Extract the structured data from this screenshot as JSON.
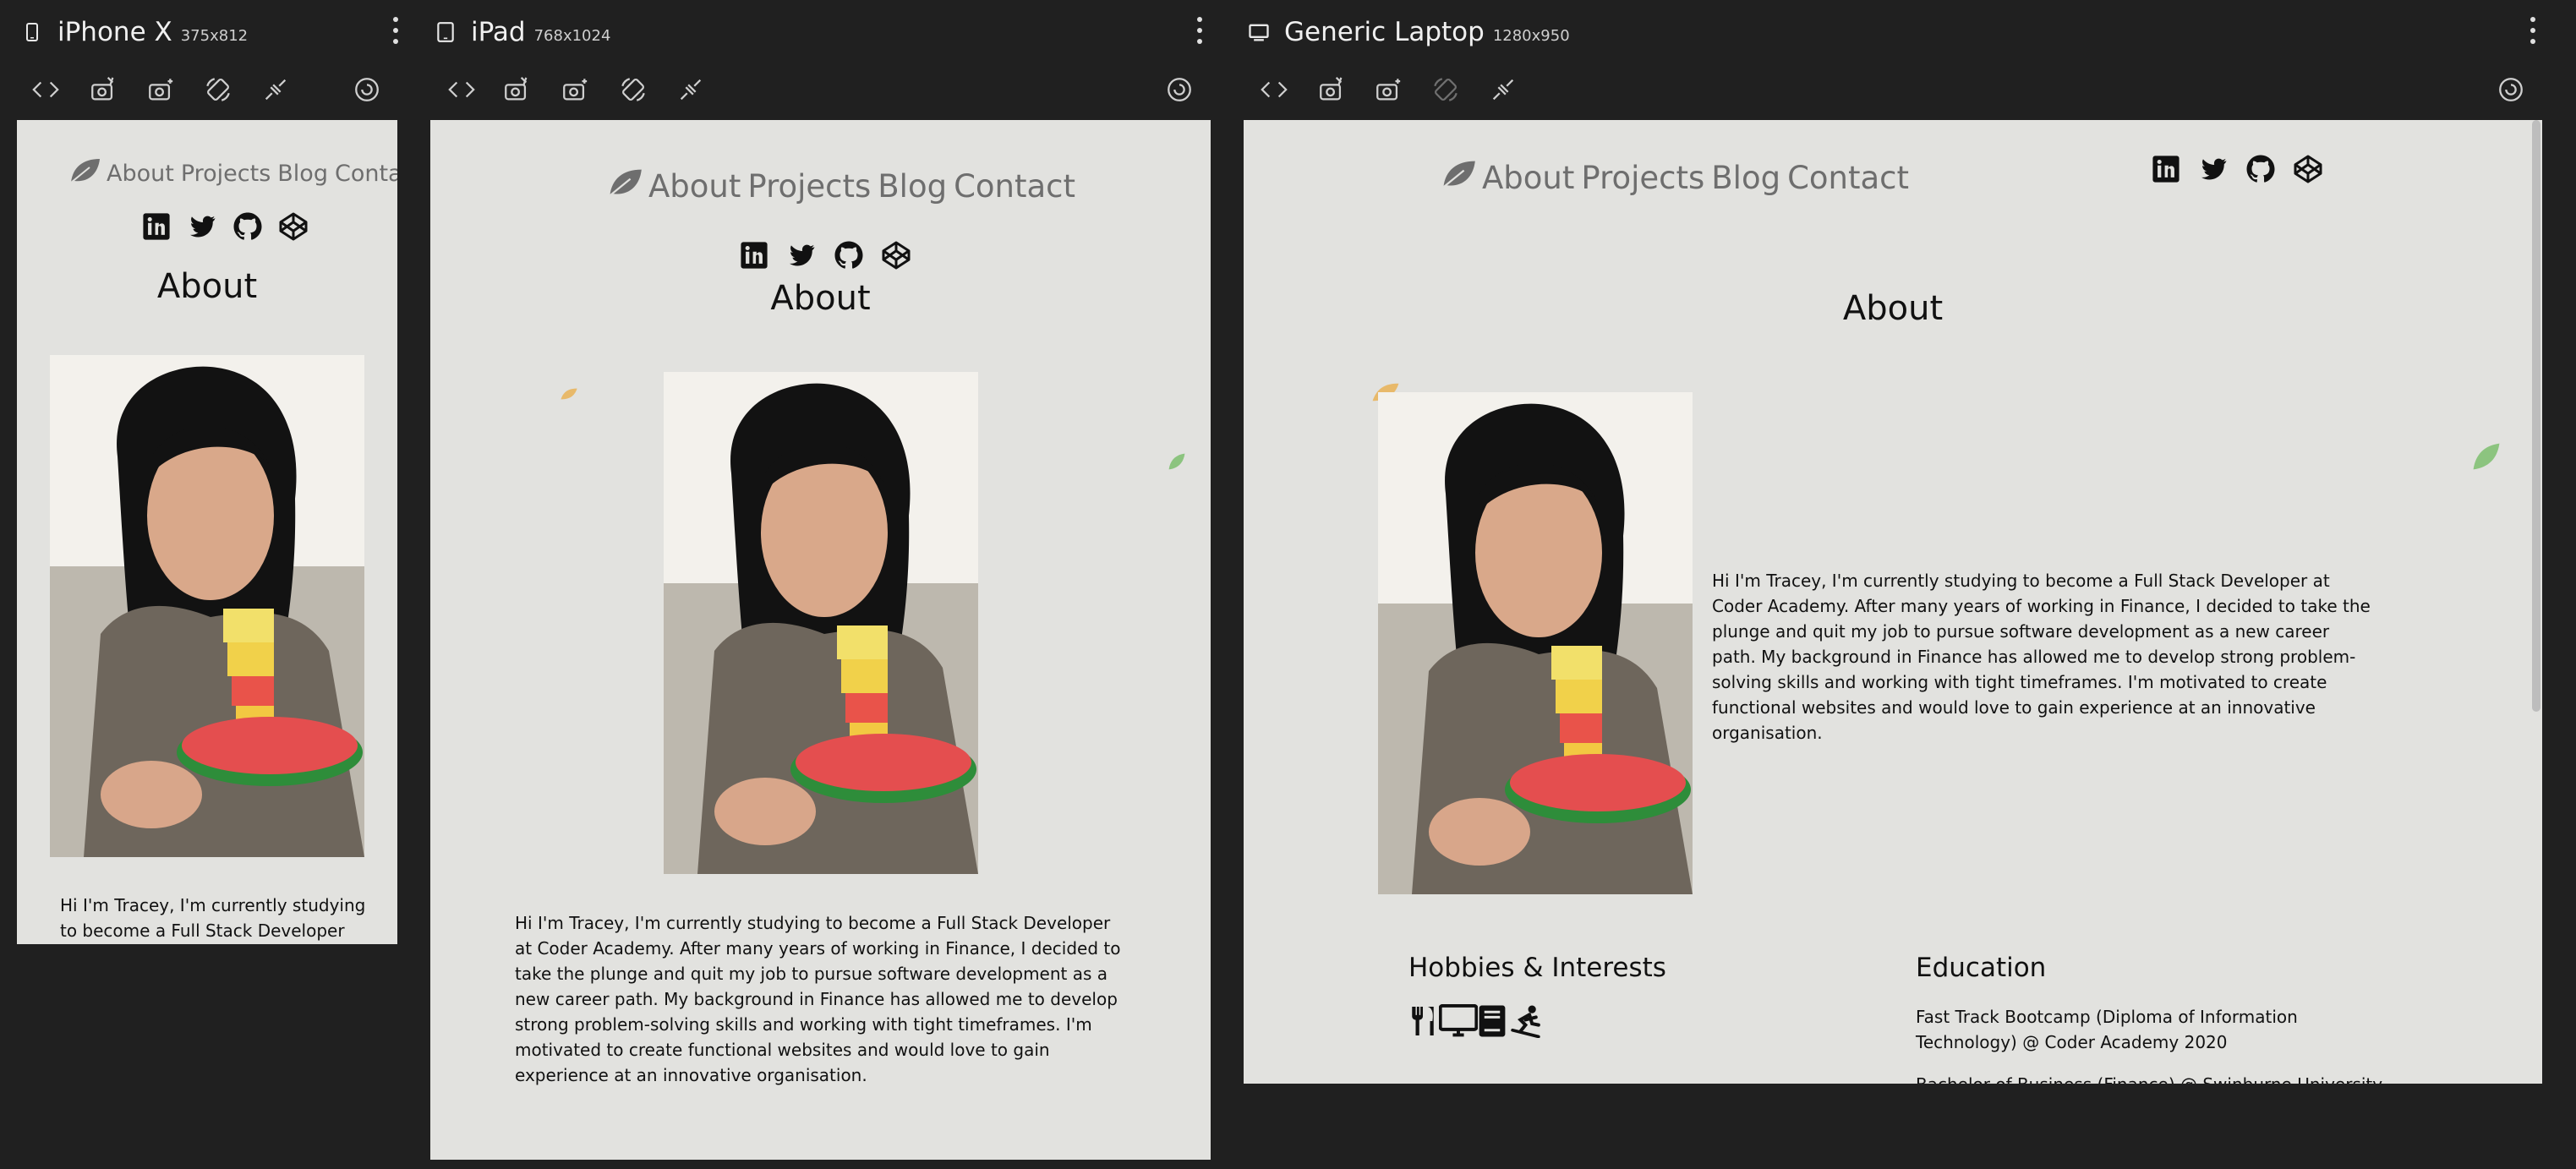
{
  "devices": [
    {
      "name": "iPhone X",
      "size": "375x812"
    },
    {
      "name": "iPad",
      "size": "768x1024"
    },
    {
      "name": "Generic Laptop",
      "size": "1280x950"
    }
  ],
  "toolbar_icons": [
    "code-icon",
    "screenshot-icon",
    "camera-icon",
    "rotate-icon",
    "disconnect-icon",
    "refresh-icon"
  ],
  "site": {
    "nav": {
      "about": "About",
      "projects": "Projects",
      "blog": "Blog",
      "contact": "Contact"
    },
    "socials": [
      "linkedin-icon",
      "twitter-icon",
      "github-icon",
      "codepen-icon"
    ],
    "about_heading": "About",
    "bio_short_line1": "Hi I'm Tracey, I'm currently studying",
    "bio_short_line2": "to become a Full Stack Developer",
    "bio": "Hi I'm Tracey, I'm currently studying to become a Full Stack Developer at Coder Academy. After many years of working in Finance, I decided to take the plunge and quit my job to pursue software development as a new career path. My background in Finance has allowed me to develop strong problem-solving skills and working with tight timeframes. I'm motivated to create functional websites and would love to gain experience at an innovative organisation.",
    "hobbies_title": "Hobbies & Interests",
    "hobby_icons": [
      "cutlery-icon",
      "computer-icon",
      "book-icon",
      "snowboard-icon"
    ],
    "education_title": "Education",
    "education": [
      "Fast Track Bootcamp (Diploma of Information Technology) @ Coder Academy 2020",
      "Bachelor of Business (Finance) @ Swinburne University"
    ]
  },
  "colors": {
    "app_bg": "#202020",
    "page_bg": "#e2e2df",
    "nav_text": "#6e6e6e",
    "leaf_orange": "#e8b96a",
    "leaf_green": "#8cc47f"
  }
}
